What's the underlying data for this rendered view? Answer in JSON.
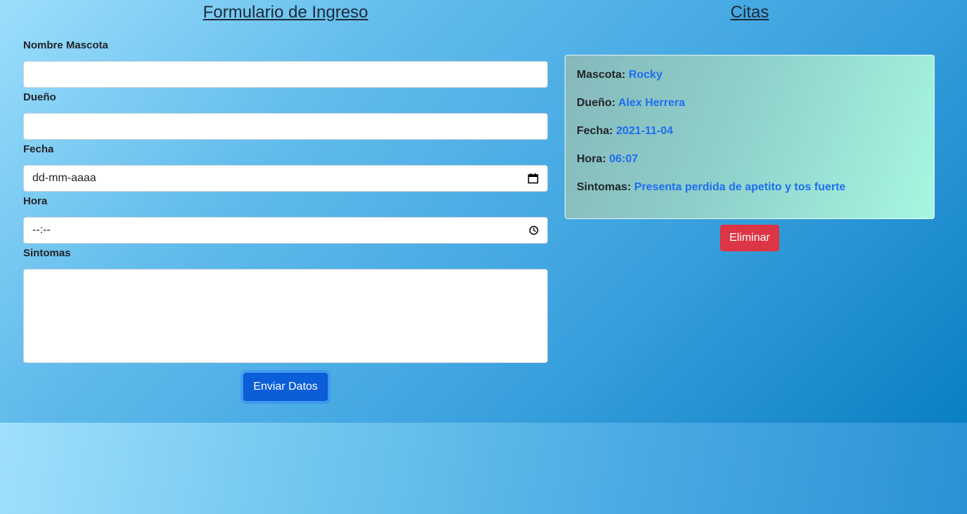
{
  "form": {
    "title": "Formulario de Ingreso",
    "fields": {
      "mascota_label": "Nombre Mascota",
      "mascota_value": "",
      "dueno_label": "Dueño",
      "dueno_value": "",
      "fecha_label": "Fecha",
      "fecha_placeholder": "dd-mm-aaaa",
      "hora_label": "Hora",
      "hora_placeholder": "--:--",
      "sintomas_label": "Sintomas",
      "sintomas_value": ""
    },
    "submit_label": "Enviar Datos"
  },
  "citas": {
    "title": "Citas",
    "items": [
      {
        "mascota_key": "Mascota:",
        "mascota": "Rocky",
        "dueno_key": "Dueño:",
        "dueno": "Alex Herrera",
        "fecha_key": "Fecha:",
        "fecha": "2021-11-04",
        "hora_key": "Hora:",
        "hora": "06:07",
        "sintomas_key": "Sintomas:",
        "sintomas": "Presenta perdida de apetito y tos fuerte",
        "delete_label": "Eliminar"
      }
    ]
  },
  "colors": {
    "primary": "#0b5ed7",
    "danger": "#dc3545",
    "value_text": "#1f6ef0"
  },
  "icons": {
    "date": "calendar-icon",
    "time": "clock-icon"
  }
}
